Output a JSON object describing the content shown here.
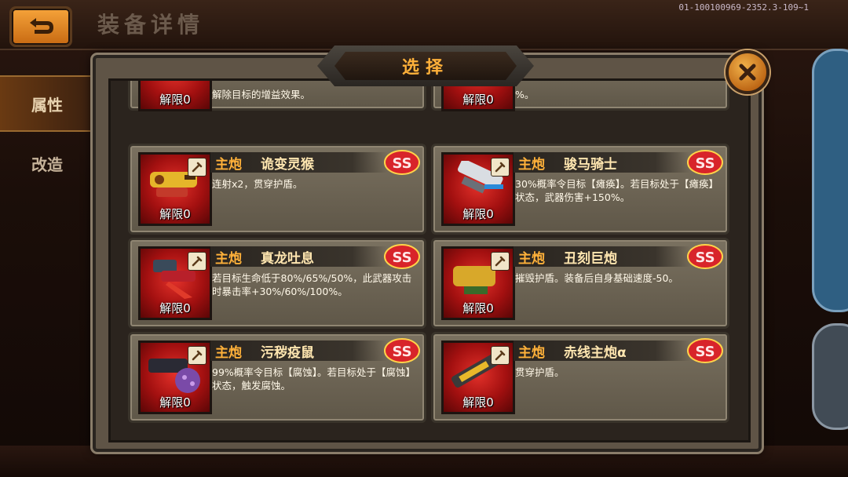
{
  "screen": {
    "title": "装备详情",
    "build_id": "01-100100969-2352.3-109~1",
    "back_icon": "back-arrow-icon"
  },
  "side_tabs": [
    {
      "label": "属性",
      "active": true
    },
    {
      "label": "改造",
      "active": false
    }
  ],
  "modal": {
    "title": "选择",
    "close_icon": "close-icon"
  },
  "partial_cards": [
    {
      "desc": "解除目标的增益效果。",
      "lock_label": "解限0"
    },
    {
      "desc": "%。",
      "lock_label": "解限0"
    }
  ],
  "cards": [
    {
      "slot": "主炮",
      "name": "诡变灵猴",
      "rank": "SS",
      "desc": "连射x2，贯穿护盾。",
      "lock_label": "解限0"
    },
    {
      "slot": "主炮",
      "name": "骏马骑士",
      "rank": "SS",
      "desc": "30%概率令目标【瘫痪】。若目标处于【瘫痪】状态，武器伤害+150%。",
      "lock_label": "解限0"
    },
    {
      "slot": "主炮",
      "name": "真龙吐息",
      "rank": "SS",
      "desc": "若目标生命低于80%/65%/50%，此武器攻击时暴击率+30%/60%/100%。",
      "lock_label": "解限0"
    },
    {
      "slot": "主炮",
      "name": "丑刻巨炮",
      "rank": "SS",
      "desc": "摧毁护盾。装备后自身基础速度-50。",
      "lock_label": "解限0"
    },
    {
      "slot": "主炮",
      "name": "污秽疫鼠",
      "rank": "SS",
      "desc": "99%概率令目标【腐蚀】。若目标处于【腐蚀】状态，触发腐蚀。",
      "lock_label": "解限0"
    },
    {
      "slot": "主炮",
      "name": "赤线主炮α",
      "rank": "SS",
      "desc": "贯穿护盾。",
      "lock_label": "解限0"
    }
  ],
  "colors": {
    "accent": "#ffb13a",
    "icon_bg": "#c21d18",
    "rank_badge": "#d8242a"
  }
}
